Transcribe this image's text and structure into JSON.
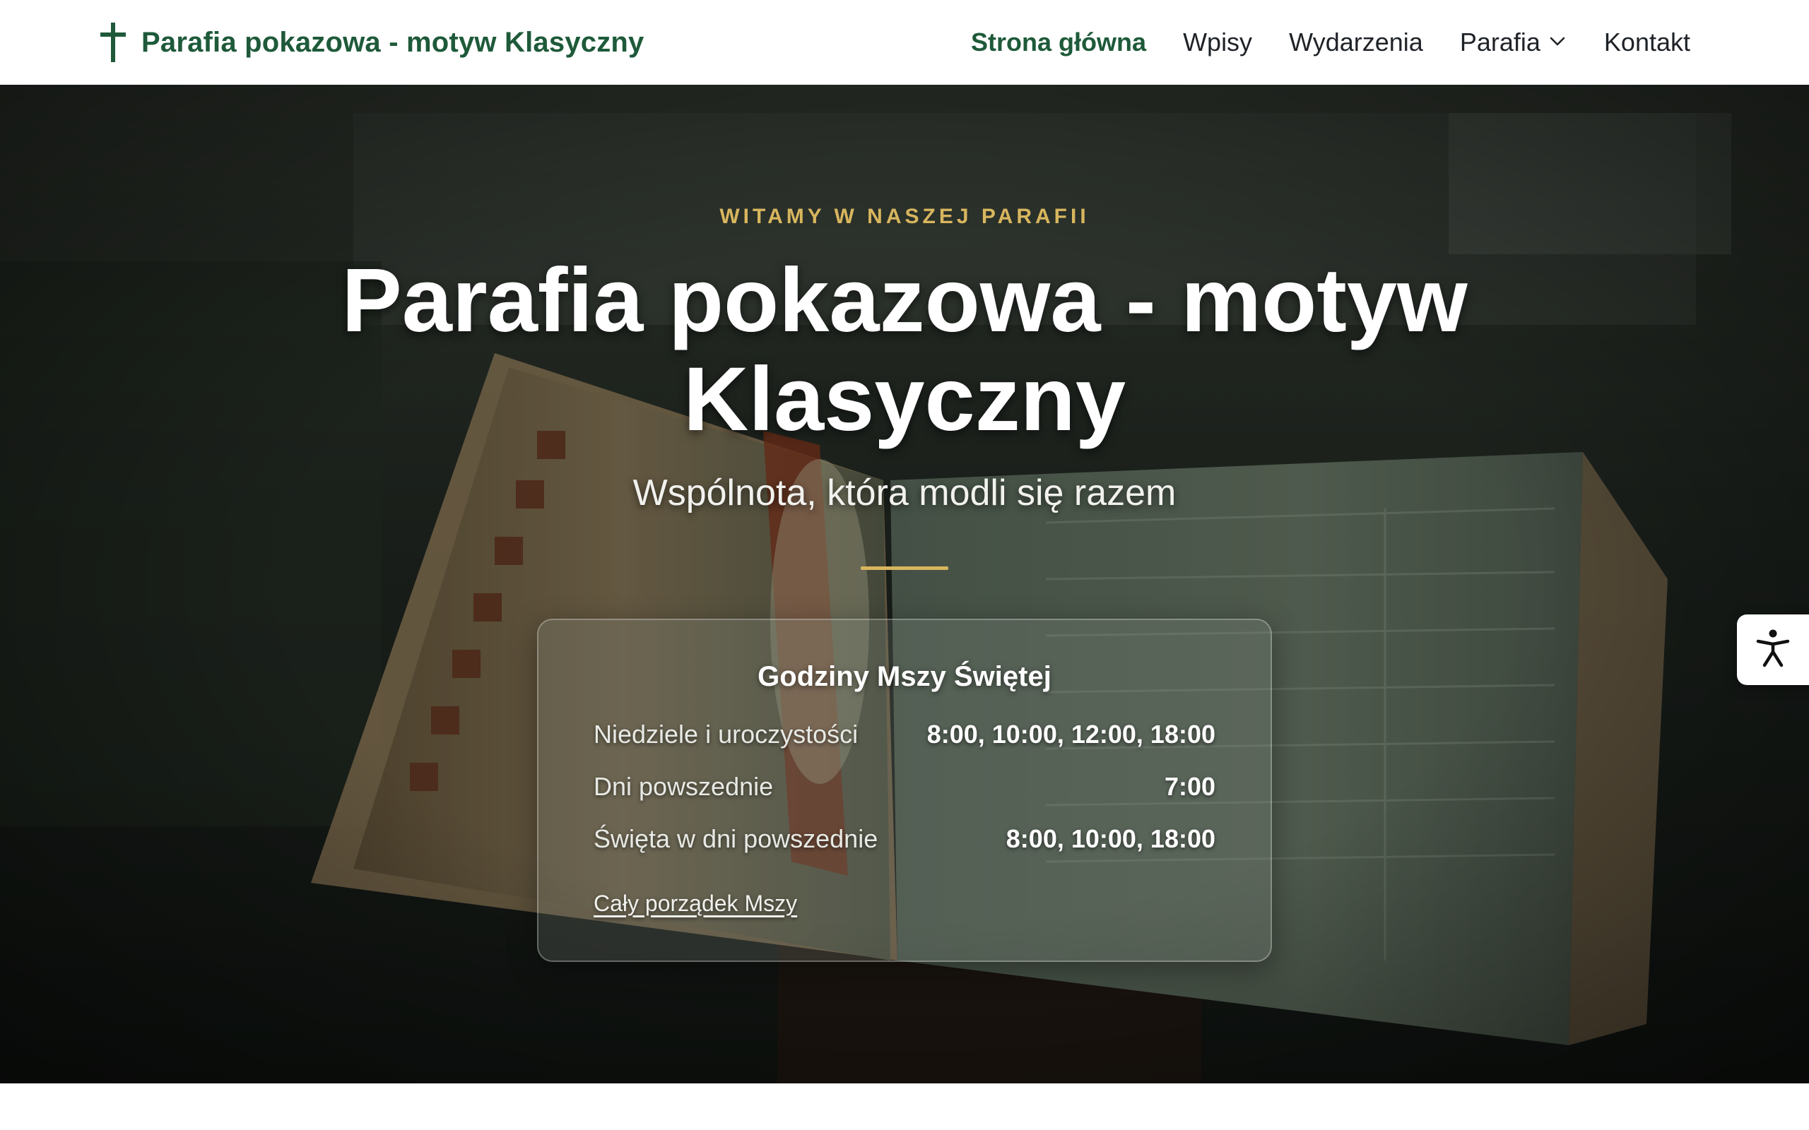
{
  "header": {
    "brand_title": "Parafia pokazowa - motyw Klasyczny",
    "brand_icon": "cross-icon",
    "brand_color": "#1e5a3a"
  },
  "nav": {
    "items": [
      {
        "label": "Strona główna",
        "active": true
      },
      {
        "label": "Wpisy",
        "active": false
      },
      {
        "label": "Wydarzenia",
        "active": false
      },
      {
        "label": "Parafia",
        "active": false,
        "dropdown": true
      },
      {
        "label": "Kontakt",
        "active": false
      }
    ]
  },
  "hero": {
    "eyebrow": "WITAMY W NASZEJ PARAFII",
    "title": "Parafia pokazowa - motyw Klasyczny",
    "subtitle": "Wspólnota, która modli się razem",
    "accent_color": "#d8b65e"
  },
  "mass_times": {
    "title": "Godziny Mszy Świętej",
    "rows": [
      {
        "label": "Niedziele i uroczystości",
        "times": "8:00, 10:00, 12:00, 18:00"
      },
      {
        "label": "Dni powszednie",
        "times": "7:00"
      },
      {
        "label": "Święta w dni powszednie",
        "times": "8:00, 10:00, 18:00"
      }
    ],
    "link_label": "Cały porządek Mszy"
  },
  "accessibility": {
    "icon": "accessibility-icon"
  }
}
